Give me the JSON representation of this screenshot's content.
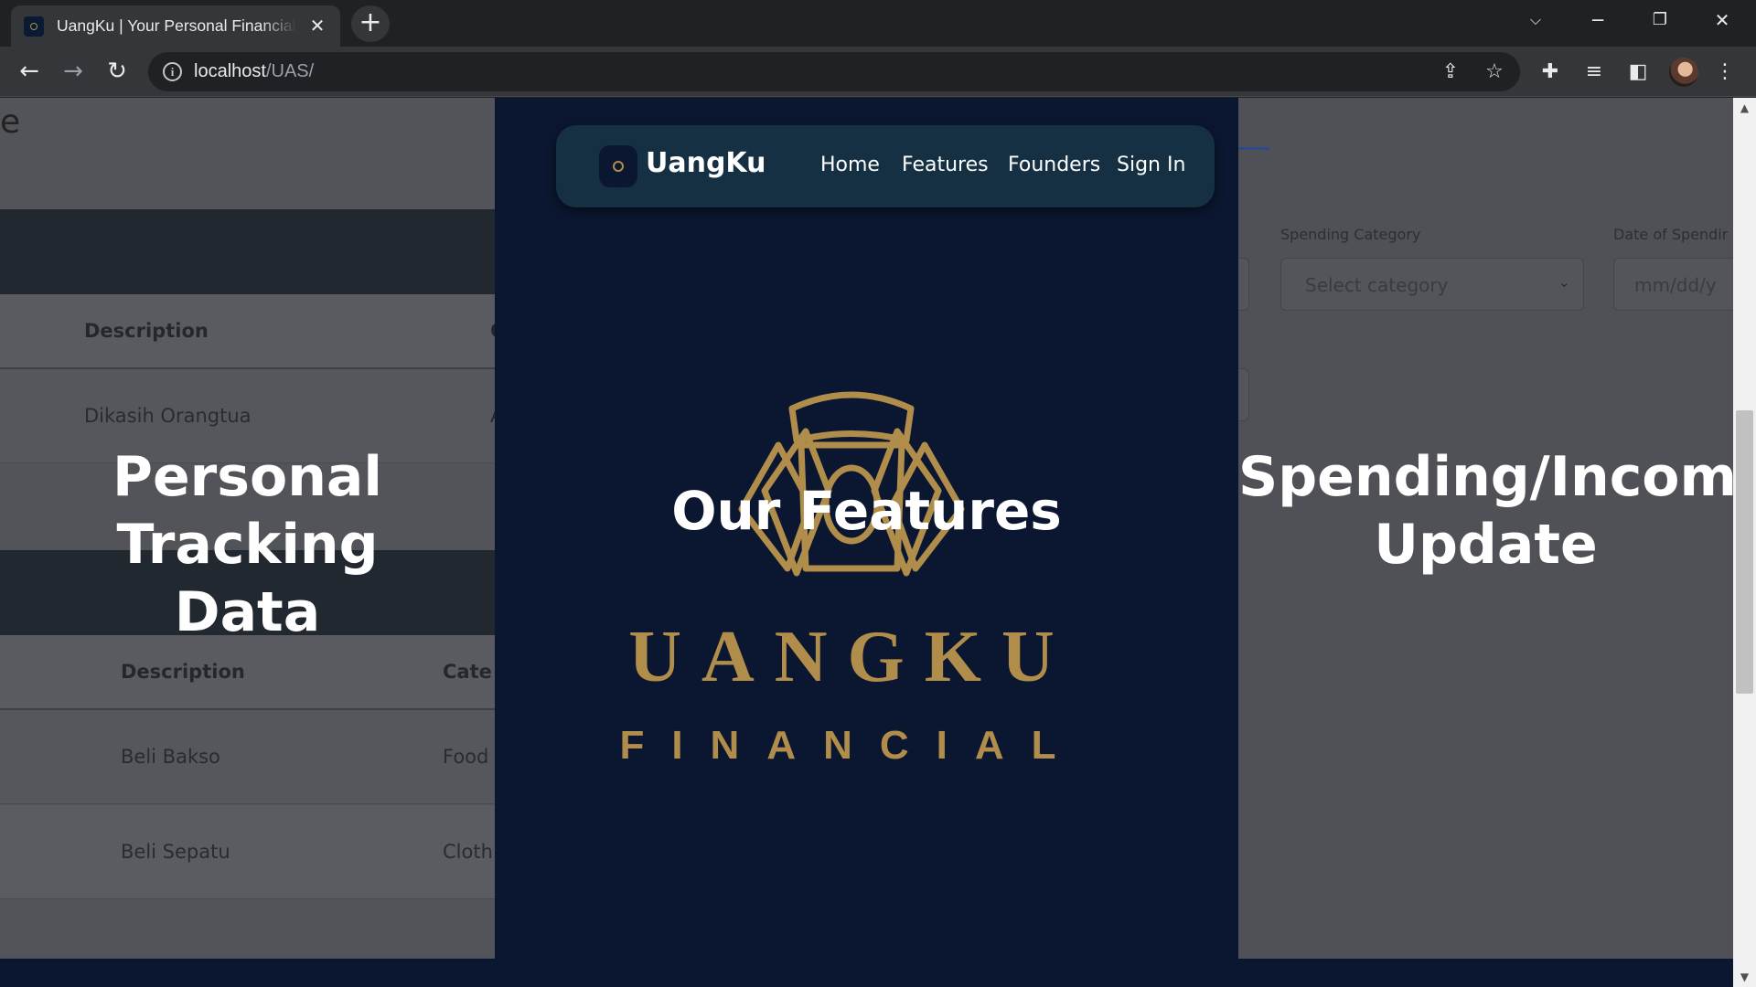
{
  "browser": {
    "tab_title": "UangKu | Your Personal Financial",
    "new_tab_symbol": "+",
    "url_host": "localhost",
    "url_path": "/UAS/"
  },
  "navbar": {
    "brand": "UangKu",
    "links": [
      "Home",
      "Features",
      "Founders",
      "Sign In"
    ]
  },
  "hero": {
    "title": "Our Features",
    "logo_word": "UANGKU",
    "logo_subword": "FINANCIAL"
  },
  "left_panel": {
    "title_line1": "Personal Tracking",
    "title_line2": "Data",
    "heading_fragment": "e",
    "income_table": {
      "header_description": "Description",
      "header_next": "C",
      "rows": [
        {
          "description": "Dikasih Orangtua",
          "next": "A"
        }
      ]
    },
    "spending_table": {
      "header_description": "Description",
      "header_category": "Cate",
      "rows": [
        {
          "description": "Beli Bakso",
          "category": "Food"
        },
        {
          "description": "Beli Sepatu",
          "category": "Cloth"
        }
      ]
    }
  },
  "right_panel": {
    "title_line1": "Spending/Income",
    "title_line2": "Update",
    "category_label": "Spending Category",
    "category_placeholder": "Select category",
    "date_label": "Date of Spendir",
    "date_placeholder": "mm/dd/y"
  },
  "colors": {
    "card_bg": "#0b1730",
    "navbar_bg": "#153042",
    "gold": "#b08d4a"
  }
}
